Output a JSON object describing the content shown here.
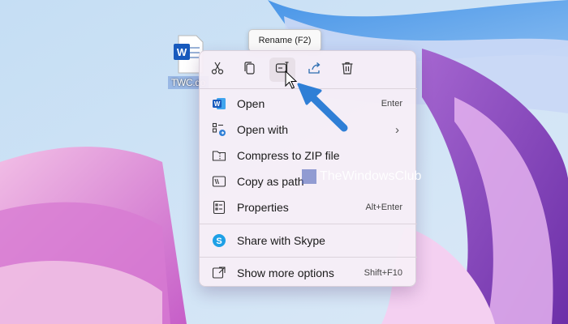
{
  "desktop": {
    "file_label": "TWC.do",
    "file_icon": "word-document-icon"
  },
  "tooltip": {
    "text": "Rename (F2)"
  },
  "toolbar": {
    "buttons": [
      {
        "name": "cut",
        "icon": "scissors-icon"
      },
      {
        "name": "copy",
        "icon": "copy-icon"
      },
      {
        "name": "rename",
        "icon": "rename-icon"
      },
      {
        "name": "share",
        "icon": "share-icon"
      },
      {
        "name": "delete",
        "icon": "trash-icon"
      }
    ]
  },
  "menu": {
    "items": [
      {
        "label": "Open",
        "shortcut": "Enter",
        "icon": "word-icon"
      },
      {
        "label": "Open with",
        "shortcut": "",
        "icon": "open-with-icon",
        "submenu": "›"
      },
      {
        "label": "Compress to ZIP file",
        "shortcut": "",
        "icon": "zip-folder-icon"
      },
      {
        "label": "Copy as path",
        "shortcut": "",
        "icon": "copy-path-icon"
      },
      {
        "label": "Properties",
        "shortcut": "Alt+Enter",
        "icon": "properties-icon"
      },
      {
        "label": "Share with Skype",
        "shortcut": "",
        "icon": "skype-icon"
      },
      {
        "label": "Show more options",
        "shortcut": "Shift+F10",
        "icon": "more-options-icon"
      }
    ]
  },
  "watermark": {
    "text": "TheWindowsClub"
  },
  "colors": {
    "accent_blue": "#2f7fd6",
    "word_blue": "#185abd",
    "skype_blue": "#1ea0e6",
    "menu_bg": "#f6eef6"
  }
}
